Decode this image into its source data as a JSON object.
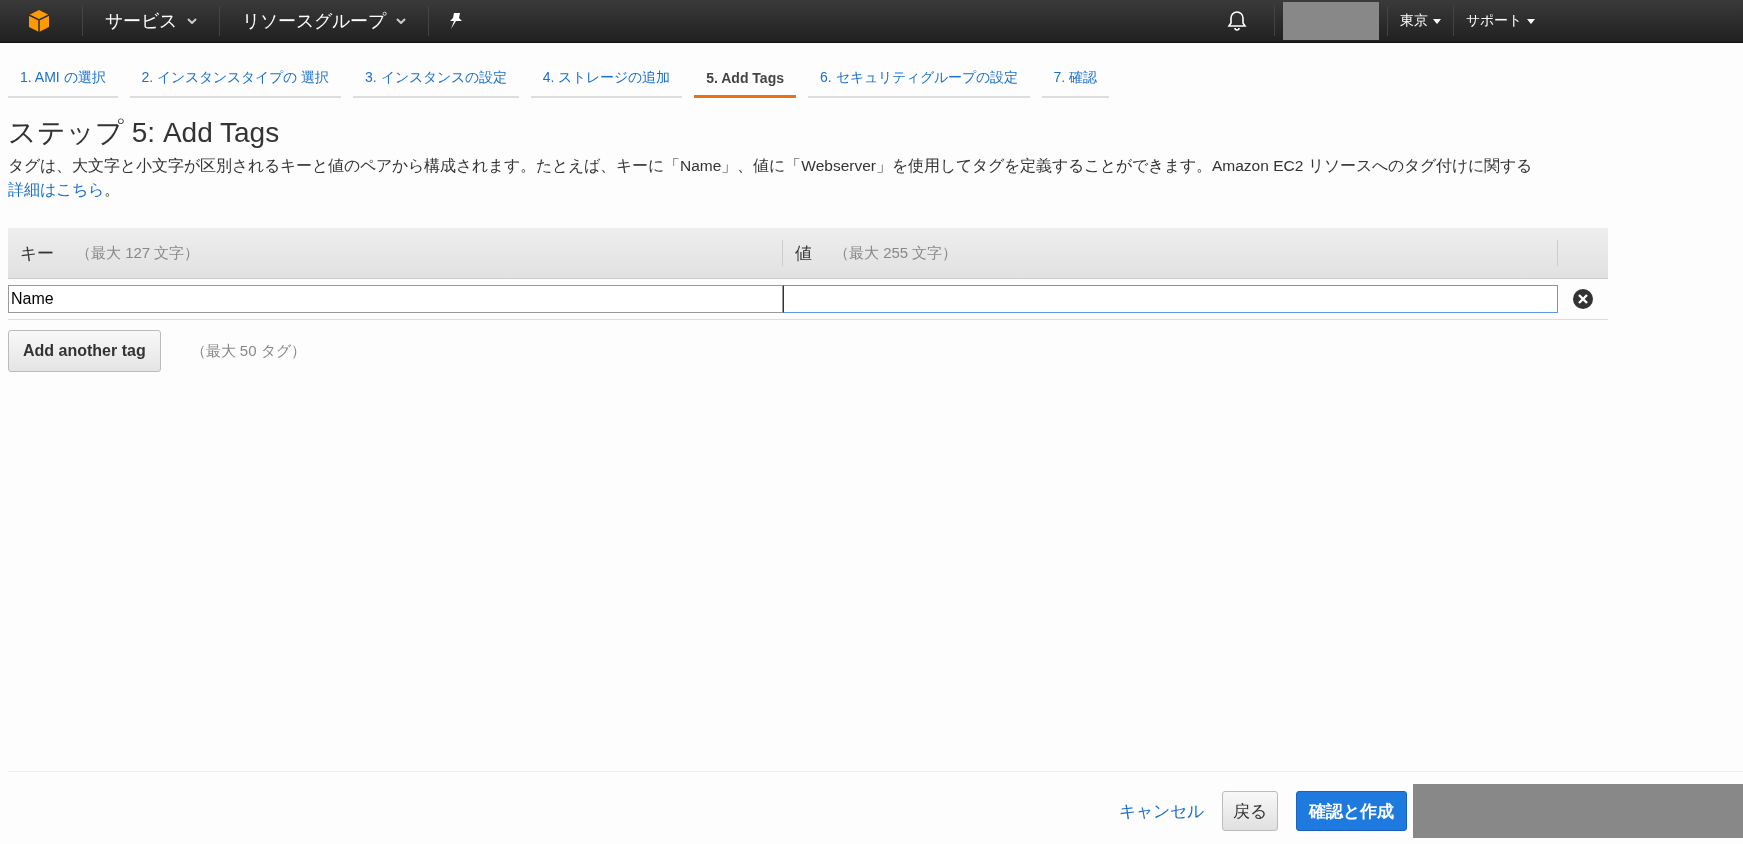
{
  "top_nav": {
    "menus": [
      {
        "label": "サービス"
      },
      {
        "label": "リソースグループ"
      }
    ],
    "region": "東京",
    "support": "サポート"
  },
  "wizard_tabs": [
    {
      "label": "1. AMI の選択",
      "selected": false
    },
    {
      "label": "2. インスタンスタイプの 選択",
      "selected": false
    },
    {
      "label": "3. インスタンスの設定",
      "selected": false
    },
    {
      "label": "4. ストレージの追加",
      "selected": false
    },
    {
      "label": "5. Add Tags",
      "selected": true
    },
    {
      "label": "6. セキュリティグループの設定",
      "selected": false
    },
    {
      "label": "7. 確認",
      "selected": false
    }
  ],
  "title": "ステップ 5: Add Tags",
  "description": "タグは、大文字と小文字が区別されるキーと値のペアから構成されます。たとえば、キーに「Name」、値に「Webserver」を使用してタグを定義することができます。Amazon EC2 リソースへのタグ付けに関する",
  "description_link": "詳細はこちら",
  "description_end": "。",
  "table": {
    "columns": [
      {
        "label": "キー",
        "hint": "（最大 127 文字）"
      },
      {
        "label": "値",
        "hint": "（最大 255 文字）"
      }
    ],
    "rows": [
      {
        "key": {
          "value": "Name",
          "focused": false
        },
        "value": {
          "focused": true
        }
      }
    ]
  },
  "add_button": "Add another tag",
  "add_hint": "（最大 50 タグ）",
  "footer": {
    "cancel": "キャンセル",
    "back": "戻る",
    "submit": "確認と作成"
  }
}
